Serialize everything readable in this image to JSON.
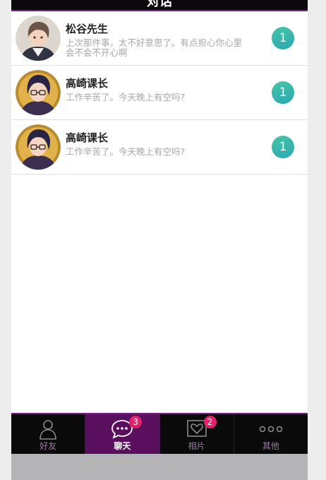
{
  "header": {
    "title": "对话"
  },
  "conversations": [
    {
      "name": "松谷先生",
      "message": "上次那件事，太不好意思了。有点担心你心里会不会不开心啊",
      "unread": "1",
      "avatar": "matsutani-avatar"
    },
    {
      "name": "高崎课长",
      "message": "工作辛苦了。今天晚上有空吗?",
      "unread": "1",
      "avatar": "takasaki-avatar"
    },
    {
      "name": "高崎课长",
      "message": "工作辛苦了。今天晚上有空吗?",
      "unread": "1",
      "avatar": "takasaki-avatar"
    }
  ],
  "tabs": [
    {
      "label": "好友",
      "icon": "person-icon",
      "count": ""
    },
    {
      "label": "聊天",
      "icon": "chat-bubble-icon",
      "count": "3"
    },
    {
      "label": "相片",
      "icon": "heart-photo-icon",
      "count": "2"
    },
    {
      "label": "其他",
      "icon": "more-dots-icon",
      "count": ""
    }
  ],
  "colors": {
    "accent": "#7a1f86",
    "active_tab": "#5a0f5e",
    "badge": "#2aa7b4",
    "tab_count": "#e4206b"
  }
}
